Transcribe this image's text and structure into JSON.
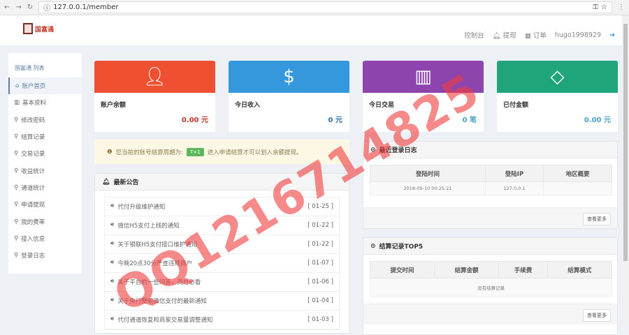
{
  "browser": {
    "url": "127.0.0.1/member"
  },
  "header": {
    "logo_text": "国富通",
    "nav": [
      "控制台",
      "提现",
      "订单"
    ],
    "username": "hugo1998929"
  },
  "sidebar": {
    "title": "国富通 列表",
    "items": [
      {
        "label": "账户首页",
        "icon": "home-icon"
      },
      {
        "label": "基本资料",
        "icon": "bar-chart-icon"
      },
      {
        "label": "修改密码",
        "icon": "key-icon"
      },
      {
        "label": "结算记录",
        "icon": "key-icon"
      },
      {
        "label": "交易记录",
        "icon": "key-icon"
      },
      {
        "label": "收益统计",
        "icon": "key-icon"
      },
      {
        "label": "通道统计",
        "icon": "key-icon"
      },
      {
        "label": "申请提现",
        "icon": "key-icon"
      },
      {
        "label": "我的费率",
        "icon": "key-icon"
      },
      {
        "label": "接入信息",
        "icon": "key-icon"
      },
      {
        "label": "登录日志",
        "icon": "key-icon"
      }
    ]
  },
  "cards": [
    {
      "label": "账户余额",
      "value": "0.00 元",
      "color": "#f05032",
      "value_color": "#c0392b",
      "icon": "user-icon"
    },
    {
      "label": "今日收入",
      "value": "0 元",
      "color": "#3598dc",
      "value_color": "#2f6fa8",
      "icon": "dollar-icon"
    },
    {
      "label": "今日交易",
      "value": "0 笔",
      "color": "#8e44ad",
      "value_color": "#4aa3c8",
      "icon": "bar-chart-icon"
    },
    {
      "label": "已付金额",
      "value": "0.00 元",
      "color": "#20a57a",
      "value_color": "#4aa3c8",
      "icon": "diamond-icon"
    }
  ],
  "alert": {
    "prefix": "您当前的账号结算周期为:",
    "badge": "T+1",
    "suffix": "进入申请结算才可以划入余额提现。"
  },
  "notices": {
    "title": "最新公告",
    "items": [
      {
        "text": "代付升级维护通知",
        "date": "[ 01-25 ]"
      },
      {
        "text": "微信H5支付上线的通知",
        "date": "[ 01-22 ]"
      },
      {
        "text": "关于银联H5支付接口维护通知",
        "date": "[ 01-22 ]"
      },
      {
        "text": "今晚20点30分严查违规商户",
        "date": "[ 01-07 ]"
      },
      {
        "text": "关于平台的一些问答，商户必看",
        "date": "[ 01-06 ]"
      },
      {
        "text": "关于央行整顿微信支付的最新通知",
        "date": "[ 01-04 ]"
      },
      {
        "text": "代付通道恢复和商家交易量调整通知",
        "date": "[ 01-03 ]"
      }
    ]
  },
  "login_log": {
    "title": "最近登录日志",
    "headers": [
      "登陆时间",
      "登陆IP",
      "地区概要"
    ],
    "rows": [
      [
        "2018-09-10 00:25:21",
        "127.0.0.1",
        ""
      ]
    ],
    "more": "查看更多"
  },
  "settle": {
    "title": "结算记录TOP5",
    "headers": [
      "提交时间",
      "结算金额",
      "手续费",
      "结算模式"
    ],
    "empty": "没有结算记录",
    "more": "查看更多"
  },
  "watermark": "QQ1216714825"
}
